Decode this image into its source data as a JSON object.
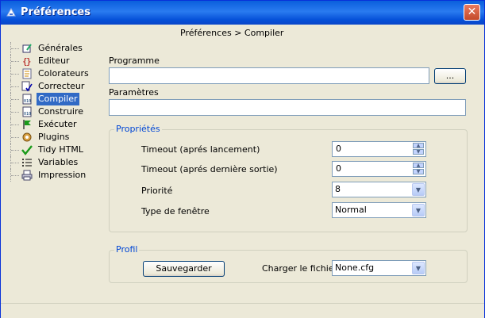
{
  "window": {
    "title": "Préférences",
    "close_label": "✕"
  },
  "breadcrumb": "Préférences > Compiler",
  "sidebar": {
    "items": [
      {
        "label": "Générales",
        "icon": "general-icon",
        "selected": false
      },
      {
        "label": "Editeur",
        "icon": "editor-icon",
        "selected": false
      },
      {
        "label": "Colorateurs",
        "icon": "highlighter-icon",
        "selected": false
      },
      {
        "label": "Correcteur",
        "icon": "spellcheck-icon",
        "selected": false
      },
      {
        "label": "Compiler",
        "icon": "compiler-icon",
        "selected": true
      },
      {
        "label": "Construire",
        "icon": "build-icon",
        "selected": false
      },
      {
        "label": "Exécuter",
        "icon": "run-flag-icon",
        "selected": false
      },
      {
        "label": "Plugins",
        "icon": "plugin-icon",
        "selected": false
      },
      {
        "label": "Tidy HTML",
        "icon": "checkmark-icon",
        "selected": false
      },
      {
        "label": "Variables",
        "icon": "list-icon",
        "selected": false
      },
      {
        "label": "Impression",
        "icon": "printer-icon",
        "selected": false
      }
    ]
  },
  "main": {
    "programme_label": "Programme",
    "programme_value": "",
    "browse_label": "...",
    "parametres_label": "Paramètres",
    "parametres_value": "",
    "proprietes": {
      "title": "Propriétés",
      "timeout_launch_label": "Timeout (aprés lancement)",
      "timeout_launch_value": "0",
      "timeout_output_label": "Timeout (aprés dernière sortie)",
      "timeout_output_value": "0",
      "priorite_label": "Priorité",
      "priorite_value": "8",
      "window_type_label": "Type de fenêtre",
      "window_type_value": "Normal"
    },
    "profil": {
      "title": "Profil",
      "save_label": "Sauvegarder",
      "load_label": "Charger le fichier",
      "load_value": "None.cfg"
    }
  },
  "colors": {
    "titlebar": "#0a5fdc",
    "selection": "#316ac5",
    "group_title": "#0046d5"
  }
}
